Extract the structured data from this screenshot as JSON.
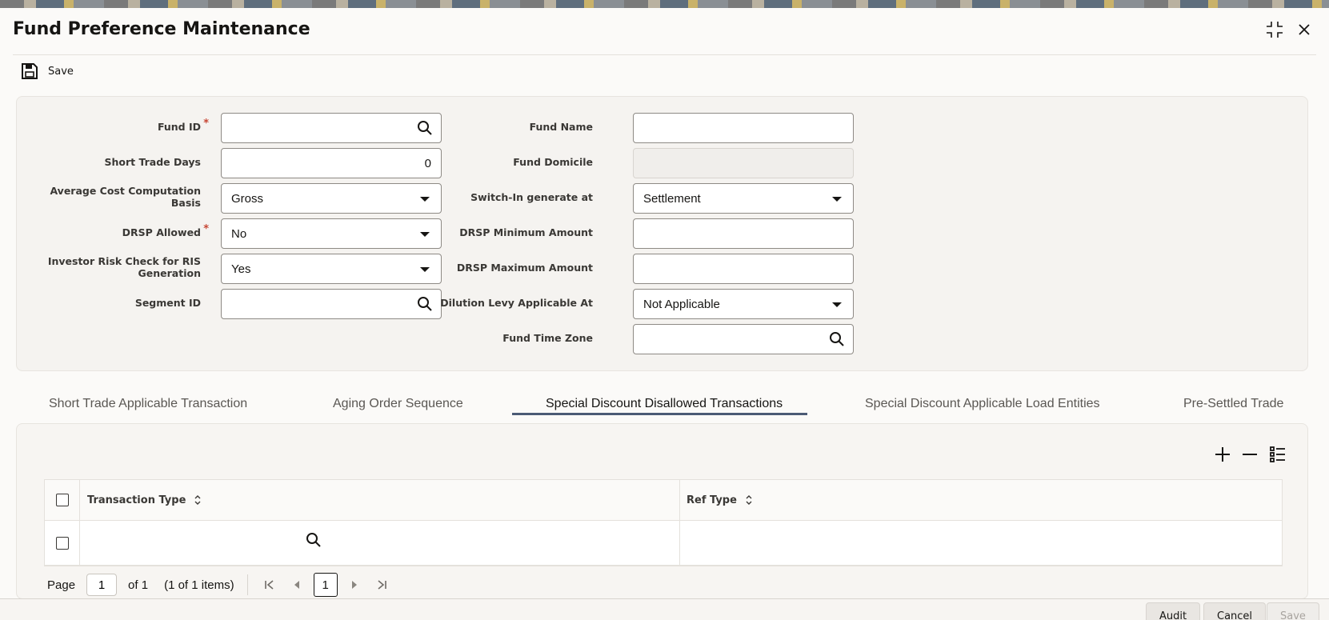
{
  "window": {
    "title": "Fund Preference Maintenance"
  },
  "toolbar": {
    "save_label": "Save"
  },
  "form": {
    "fund_id_label": "Fund ID",
    "required_mark": "*",
    "fund_name_label": "Fund Name",
    "short_trade_days_label": "Short Trade Days",
    "short_trade_days_value": "0",
    "fund_domicile_label": "Fund Domicile",
    "avg_cost_label": "Average Cost Computation Basis",
    "avg_cost_value": "Gross",
    "switch_in_label": "Switch-In generate at",
    "switch_in_value": "Settlement",
    "drsp_allowed_label": "DRSP Allowed",
    "drsp_allowed_value": "No",
    "drsp_min_label": "DRSP Minimum Amount",
    "investor_risk_label": "Investor Risk Check for RIS Generation",
    "investor_risk_value": "Yes",
    "drsp_max_label": "DRSP Maximum Amount",
    "segment_id_label": "Segment ID",
    "dilution_label": "Dilution Levy Applicable At",
    "dilution_value": "Not Applicable",
    "fund_tz_label": "Fund Time Zone"
  },
  "tabs": [
    {
      "label": "Short Trade Applicable Transaction"
    },
    {
      "label": "Aging Order Sequence"
    },
    {
      "label": "Special Discount Disallowed Transactions"
    },
    {
      "label": "Special Discount Applicable Load Entities"
    },
    {
      "label": "Pre-Settled Trade"
    }
  ],
  "grid": {
    "columns": [
      "Transaction Type",
      "Ref Type"
    ]
  },
  "pager": {
    "page_label": "Page",
    "page_value": "1",
    "of_label": "of 1",
    "items_label": "(1 of 1 items)",
    "current": "1"
  },
  "footer": {
    "audit": "Audit",
    "cancel": "Cancel",
    "save": "Save"
  },
  "colors": {
    "accent": "#4b5b75",
    "required": "#c74634"
  }
}
